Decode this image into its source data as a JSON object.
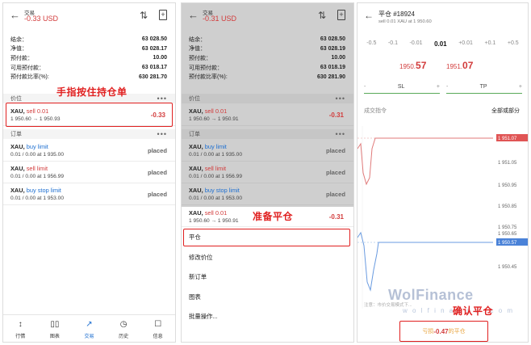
{
  "panel1": {
    "header": {
      "back": "←",
      "title": "交易",
      "balance": "-0.33 USD",
      "sort_icon": "⇅",
      "add_icon": "+"
    },
    "account": [
      {
        "label": "结余：",
        "value": "63 028.50"
      },
      {
        "label": "净值：",
        "value": "63 028.17"
      },
      {
        "label": "预付款：",
        "value": "10.00"
      },
      {
        "label": "可用预付款：",
        "value": "63 018.17"
      },
      {
        "label": "预付款比率(%):",
        "value": "630 281.70"
      }
    ],
    "positions_section": "价位",
    "section_dots": "•••",
    "position": {
      "symbol": "XAU,",
      "kind": "sell 0.01",
      "prices": "1 950.60 → 1 950.93",
      "pl": "-0.33"
    },
    "orders_section": "订单",
    "orders": [
      {
        "symbol": "XAU,",
        "kind": "buy limit",
        "detail": "0.01 / 0.00 at 1 935.00",
        "status": "placed"
      },
      {
        "symbol": "XAU,",
        "kind": "sell limit",
        "detail": "0.01 / 0.00 at 1 956.99",
        "status": "placed"
      },
      {
        "symbol": "XAU,",
        "kind": "buy stop limit",
        "detail": "0.01 / 0.00 at 1 953.00",
        "status": "placed"
      }
    ],
    "annotation": "手指按住持仓单",
    "nav": [
      {
        "icon": "↕",
        "label": "行情"
      },
      {
        "icon": "▯▯",
        "label": "图表"
      },
      {
        "icon": "↗",
        "label": "交易"
      },
      {
        "icon": "◷",
        "label": "历史"
      },
      {
        "icon": "☐",
        "label": "信息"
      }
    ]
  },
  "panel2": {
    "header": {
      "back": "←",
      "title": "交易",
      "balance": "-0.31 USD",
      "sort_icon": "⇅",
      "add_icon": "+"
    },
    "account": [
      {
        "label": "结余：",
        "value": "63 028.50"
      },
      {
        "label": "净值：",
        "value": "63 028.19"
      },
      {
        "label": "预付款：",
        "value": "10.00"
      },
      {
        "label": "可用预付款：",
        "value": "63 018.19"
      },
      {
        "label": "预付款比率(%):",
        "value": "630 281.90"
      }
    ],
    "positions_section": "价位",
    "section_dots": "•••",
    "position": {
      "symbol": "XAU,",
      "kind": "sell 0.01",
      "prices": "1 950.60 → 1 950.91",
      "pl": "-0.31"
    },
    "orders_section": "订单",
    "orders": [
      {
        "symbol": "XAU,",
        "kind": "buy limit",
        "detail": "0.01 / 0.00 at 1 935.00",
        "status": "placed"
      },
      {
        "symbol": "XAU,",
        "kind": "sell limit",
        "detail": "0.01 / 0.00 at 1 956.99",
        "status": "placed"
      },
      {
        "symbol": "XAU,",
        "kind": "buy stop limit",
        "detail": "0.01 / 0.00 at 1 953.00",
        "status": "placed"
      }
    ],
    "sel_position": {
      "symbol": "XAU,",
      "kind": "sell 0.01",
      "prices": "1 950.60 → 1 950.91",
      "pl": "-0.31"
    },
    "annotation": "准备平仓",
    "menu": [
      "平仓",
      "修改价位",
      "新订单",
      "图表",
      "批量操作..."
    ]
  },
  "panel3": {
    "back": "←",
    "title": "平仓 #18924",
    "subtitle": "sell 0.01 XAU at 1 950.60",
    "volumes": [
      "-0.5",
      "-0.1",
      "-0.01",
      "0.01",
      "+0.01",
      "+0.1",
      "+0.5"
    ],
    "bid_main": "1950.",
    "bid_big": "57",
    "ask_main": "1951.",
    "ask_big": "07",
    "sl": {
      "minus": "-",
      "label": "SL",
      "plus": "+"
    },
    "tp": {
      "minus": "-",
      "label": "TP",
      "plus": "+"
    },
    "order_type_label": "成交指令",
    "order_type_value": "全部或部分",
    "axis_labels": [
      "1 951.07",
      "1 951.05",
      "1 950.95",
      "1 950.85",
      "1 950.75",
      "1 950.65",
      "1 950.57",
      "1 950.45"
    ],
    "warning": "注意：市价交易模式下...",
    "watermark": "WolFinance",
    "watermark_url": "w o l f i n a n c e . c o m",
    "confirm_prefix": "亏损",
    "confirm_value": "-0.47",
    "confirm_suffix": "的平仓",
    "annotation": "确认平仓"
  }
}
